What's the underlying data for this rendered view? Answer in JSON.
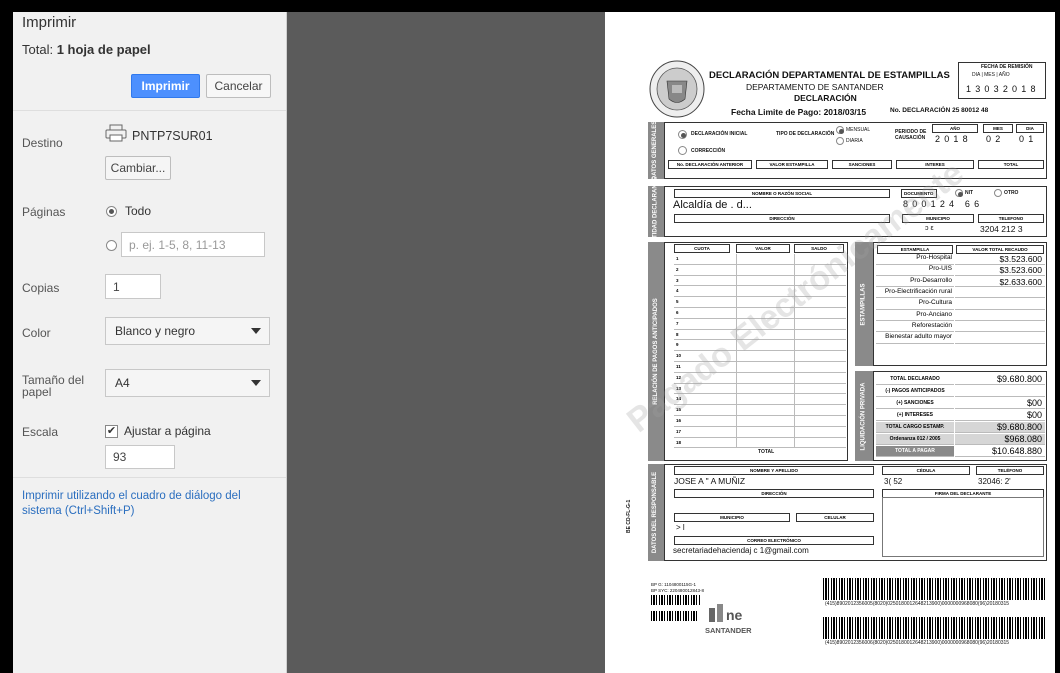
{
  "panel": {
    "title": "Imprimir",
    "total_label": "Total:",
    "total_value": "1 hoja de papel",
    "print_button": "Imprimir",
    "cancel_button": "Cancelar",
    "destination_label": "Destino",
    "printer_name": "PNTP7SUR01",
    "change_button": "Cambiar...",
    "pages_label": "Páginas",
    "pages_all": "Todo",
    "pages_placeholder": "p. ej. 1-5, 8, 11-13",
    "copies_label": "Copias",
    "copies_value": "1",
    "color_label": "Color",
    "color_value": "Blanco y negro",
    "paper_label_1": "Tamaño del",
    "paper_label_2": "papel",
    "paper_value": "A4",
    "scale_label": "Escala",
    "fit_page": "Ajustar a página",
    "scale_value": "93",
    "system_dialog_link": "Imprimir utilizando el cuadro de diálogo del sistema (Ctrl+Shift+P)"
  },
  "form": {
    "title": "DECLARACIÓN DEPARTAMENTAL DE ESTAMPILLAS",
    "subtitle": "DEPARTAMENTO DE SANTANDER",
    "subtitle2": "DECLARACIÓN",
    "deadline": "Fecha Limite de Pago: 2018/03/15",
    "decl_no": "No. DECLARACIÓN 25  80012 48",
    "remision_label": "FECHA DE REMISIÓN",
    "remision_hdr": "DIA | MES | AÑO",
    "remision_digits": "13032018",
    "sec_general": "DATOS GENERALES",
    "decl_inicial": "DECLARACIÓN INICIAL",
    "correccion": "CORRECCIÓN",
    "tipo_decl": "TIPO DE DECLARACIÓN",
    "mensual": "MENSUAL",
    "diaria": "DIARIA",
    "periodo": "PERIODO DE CAUSACIÓN",
    "anio_hdr": "AÑO",
    "mes_hdr": "MES",
    "dia_hdr": "DIA",
    "periodo_anio": "2018",
    "periodo_mes": "02",
    "periodo_dia": "01",
    "h_no_decl": "No. DECLARACIÓN ANTERIOR",
    "h_valor_est": "VALOR ESTAMPILLA",
    "h_sanciones": "SANCIONES",
    "h_intereses": "INTERES",
    "h_total": "TOTAL",
    "sec_entidad": "ENTIDAD DECLARANTE",
    "h_nombre": "NOMBRE O RAZÓN SOCIAL",
    "nombre": "Alcaldía de   .  d...",
    "h_documento": "DOCUMENTO",
    "nit": "NIT",
    "otro": "OTRO",
    "doc_digits": "800124  66",
    "h_direccion": "DIRECCIÓN",
    "h_municipio": "MUNICIPIO",
    "municipio": "ɔ  ε",
    "h_telefono": "TELEFONO",
    "telefono": "3204  212  3",
    "sec_pagos": "RELACIÓN DE PAGOS ANTICIPADOS",
    "h_cuota": "CUOTA",
    "h_valor": "VALOR",
    "h_saldo": "SALDO",
    "total_lbl": "TOTAL",
    "sec_estampillas": "ESTAMPILLAS",
    "h_estampilla": "ESTAMPILLA",
    "h_valor_total": "VALOR TOTAL RECAUDO",
    "estampillas": [
      {
        "name": "Pro-Hospital",
        "value": "$3.523.600"
      },
      {
        "name": "Pro-UIS",
        "value": "$3.523.600"
      },
      {
        "name": "Pro-Desarrollo",
        "value": "$2.633.600"
      },
      {
        "name": "Pro-Electrificación rural",
        "value": ""
      },
      {
        "name": "Pro-Cultura",
        "value": ""
      },
      {
        "name": "Pro-Anciano",
        "value": ""
      },
      {
        "name": "Reforestación",
        "value": ""
      },
      {
        "name": "Bienestar adulto mayor",
        "value": ""
      }
    ],
    "sec_liquidacion": "LIQUIDACIÓN PRIVADA",
    "liquidacion": [
      {
        "name": "TOTAL DECLARADO",
        "value": "$9.680.800"
      },
      {
        "name": "(-) PAGOS ANTICIPADOS",
        "value": ""
      },
      {
        "name": "(+) SANCIONES",
        "value": "$00"
      },
      {
        "name": "(+) INTERESES",
        "value": "$00"
      },
      {
        "name": "TOTAL CARGO ESTAMP.",
        "value": "$9.680.800"
      },
      {
        "name": "Ordenanza 012 / 2005",
        "value": "$968.080"
      },
      {
        "name": "TOTAL A PAGAR",
        "value": "$10.648.880"
      }
    ],
    "sec_responsable": "DATOS DEL RESPONSABLE",
    "h_nombre_apellido": "NOMBRE Y APELLIDO",
    "responsable": "JOSE    A   \"  A MUÑIZ",
    "h_cedula": "CÉDULA",
    "cedula": "3(  52",
    "h_tel2": "TELÉFONO",
    "tel2": "32046:  2'",
    "h_direccion2": "DIRECCIÓN",
    "h_firma": "FIRMA DEL DECLARANTE",
    "h_municipio2": "MUNICIPIO",
    "municipio2": "> l",
    "h_celular": "CELULAR",
    "h_correo": "CORREO ELECTRÓNICO",
    "correo": "secretariadehaciendaj  c  1@gmail.com",
    "code_side": "BE CD-FL-G-1",
    "bp1": "BP G: 1104800115G-1",
    "bp2": "BP SYC: 220480012843-8",
    "logo_text": "SANTANDER",
    "barcode_text_1": "(415)8902012356005(8020)0250180012648213900)0000000968080(96)20180315",
    "barcode_text_2": "(415)8902012356006(8020)0250180012648213900)0000000968080(96)20180315",
    "watermark": "Pagado Electrónicamente"
  }
}
